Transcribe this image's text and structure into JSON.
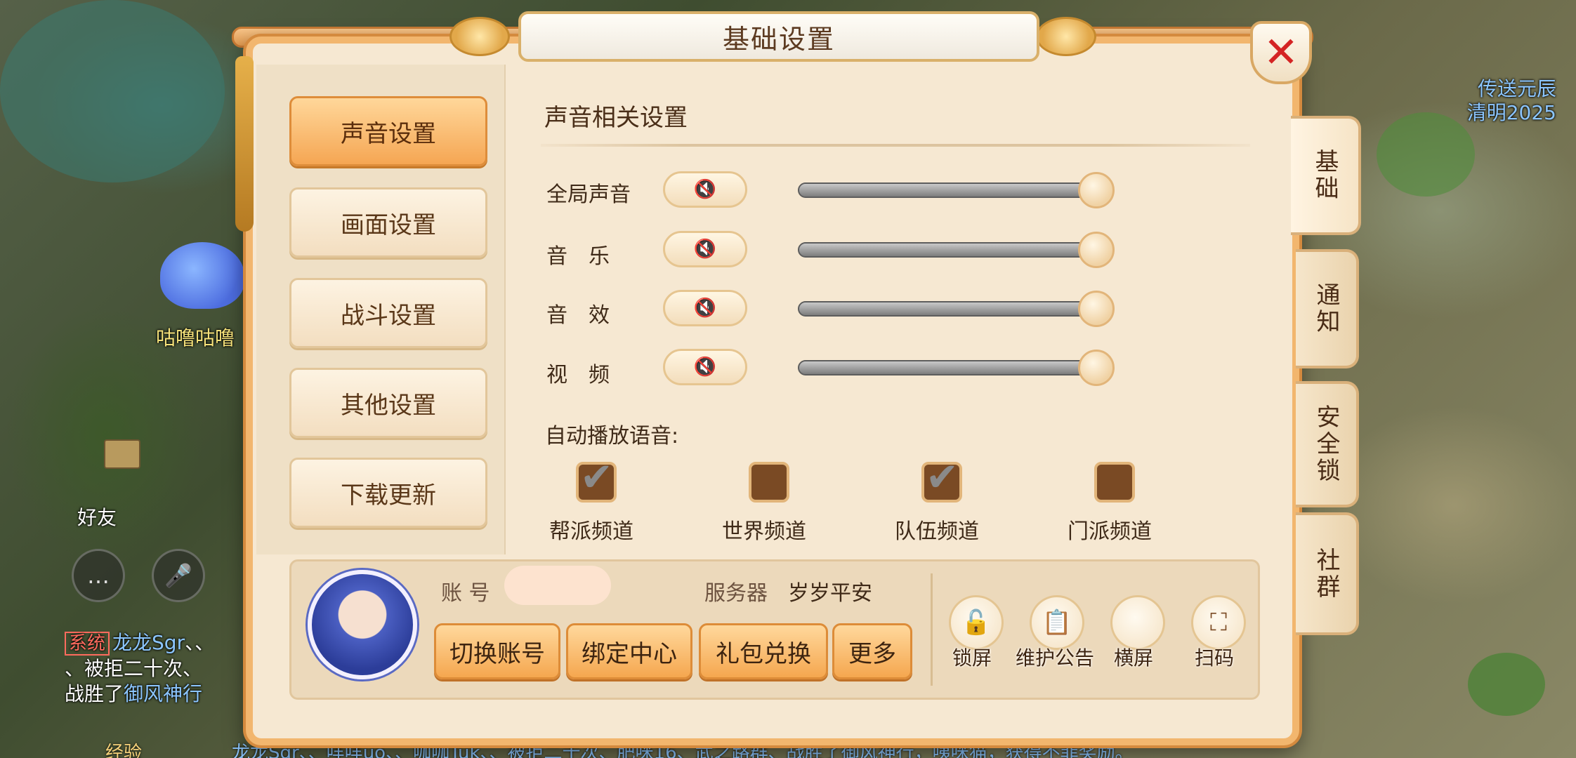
{
  "dialog": {
    "title": "基础设置",
    "close_label": "✕"
  },
  "menu": {
    "items": [
      {
        "label": "声音设置",
        "active": true
      },
      {
        "label": "画面设置",
        "active": false
      },
      {
        "label": "战斗设置",
        "active": false
      },
      {
        "label": "其他设置",
        "active": false
      },
      {
        "label": "下载更新",
        "active": false
      }
    ]
  },
  "side_tabs": [
    {
      "label": "基础",
      "active": true
    },
    {
      "label": "通知",
      "active": false
    },
    {
      "label": "安全锁",
      "active": false
    },
    {
      "label": "社群",
      "active": false
    }
  ],
  "sound": {
    "section_title": "声音相关设置",
    "rows": [
      {
        "label": "全局声音",
        "level": 1.0
      },
      {
        "label": "音　乐",
        "level": 1.0
      },
      {
        "label": "音　效",
        "level": 1.0
      },
      {
        "label": "视　频",
        "level": 1.0
      }
    ],
    "mute_icon": "🔇",
    "auto_play_label": "自动播放语音:",
    "channels": [
      {
        "label": "帮派频道",
        "checked": true
      },
      {
        "label": "世界频道",
        "checked": false
      },
      {
        "label": "队伍频道",
        "checked": true
      },
      {
        "label": "门派频道",
        "checked": false
      }
    ],
    "tick_glyph": "✔"
  },
  "account": {
    "account_label": "账 号",
    "server_label": "服务器",
    "server_value": "岁岁平安",
    "buttons": [
      {
        "label": "切换账号"
      },
      {
        "label": "绑定中心"
      },
      {
        "label": "礼包兑换"
      },
      {
        "label": "更多"
      }
    ],
    "tools": [
      {
        "label": "锁屏",
        "icon": "lock-icon",
        "glyph": "🔓"
      },
      {
        "label": "维护公告",
        "icon": "notice-icon",
        "glyph": "📋"
      },
      {
        "label": "横屏",
        "icon": "rotate-icon",
        "glyph": ""
      },
      {
        "label": "扫码",
        "icon": "scan-icon",
        "glyph": "⛶"
      }
    ]
  },
  "background": {
    "pet_name": "咕噜咕噜",
    "portal_line1": "传送元辰",
    "portal_line2": "清明2025",
    "friend_label": "好友",
    "chat": {
      "system_tag": "系统",
      "line1_name": "龙龙Sgr",
      "line1_rest": "、、",
      "line2": "、被拒二十次、",
      "line3_a": "战胜了",
      "line3_b": "御风神行"
    },
    "ticker": "龙龙Sgr、、咩咩uo、、咖咖Tuk、、被拒二十次、肥咪16、武之路群、战胜了御风神行，咦咪猫，获得不菲奖励。",
    "ticker_prefix": "经验"
  }
}
